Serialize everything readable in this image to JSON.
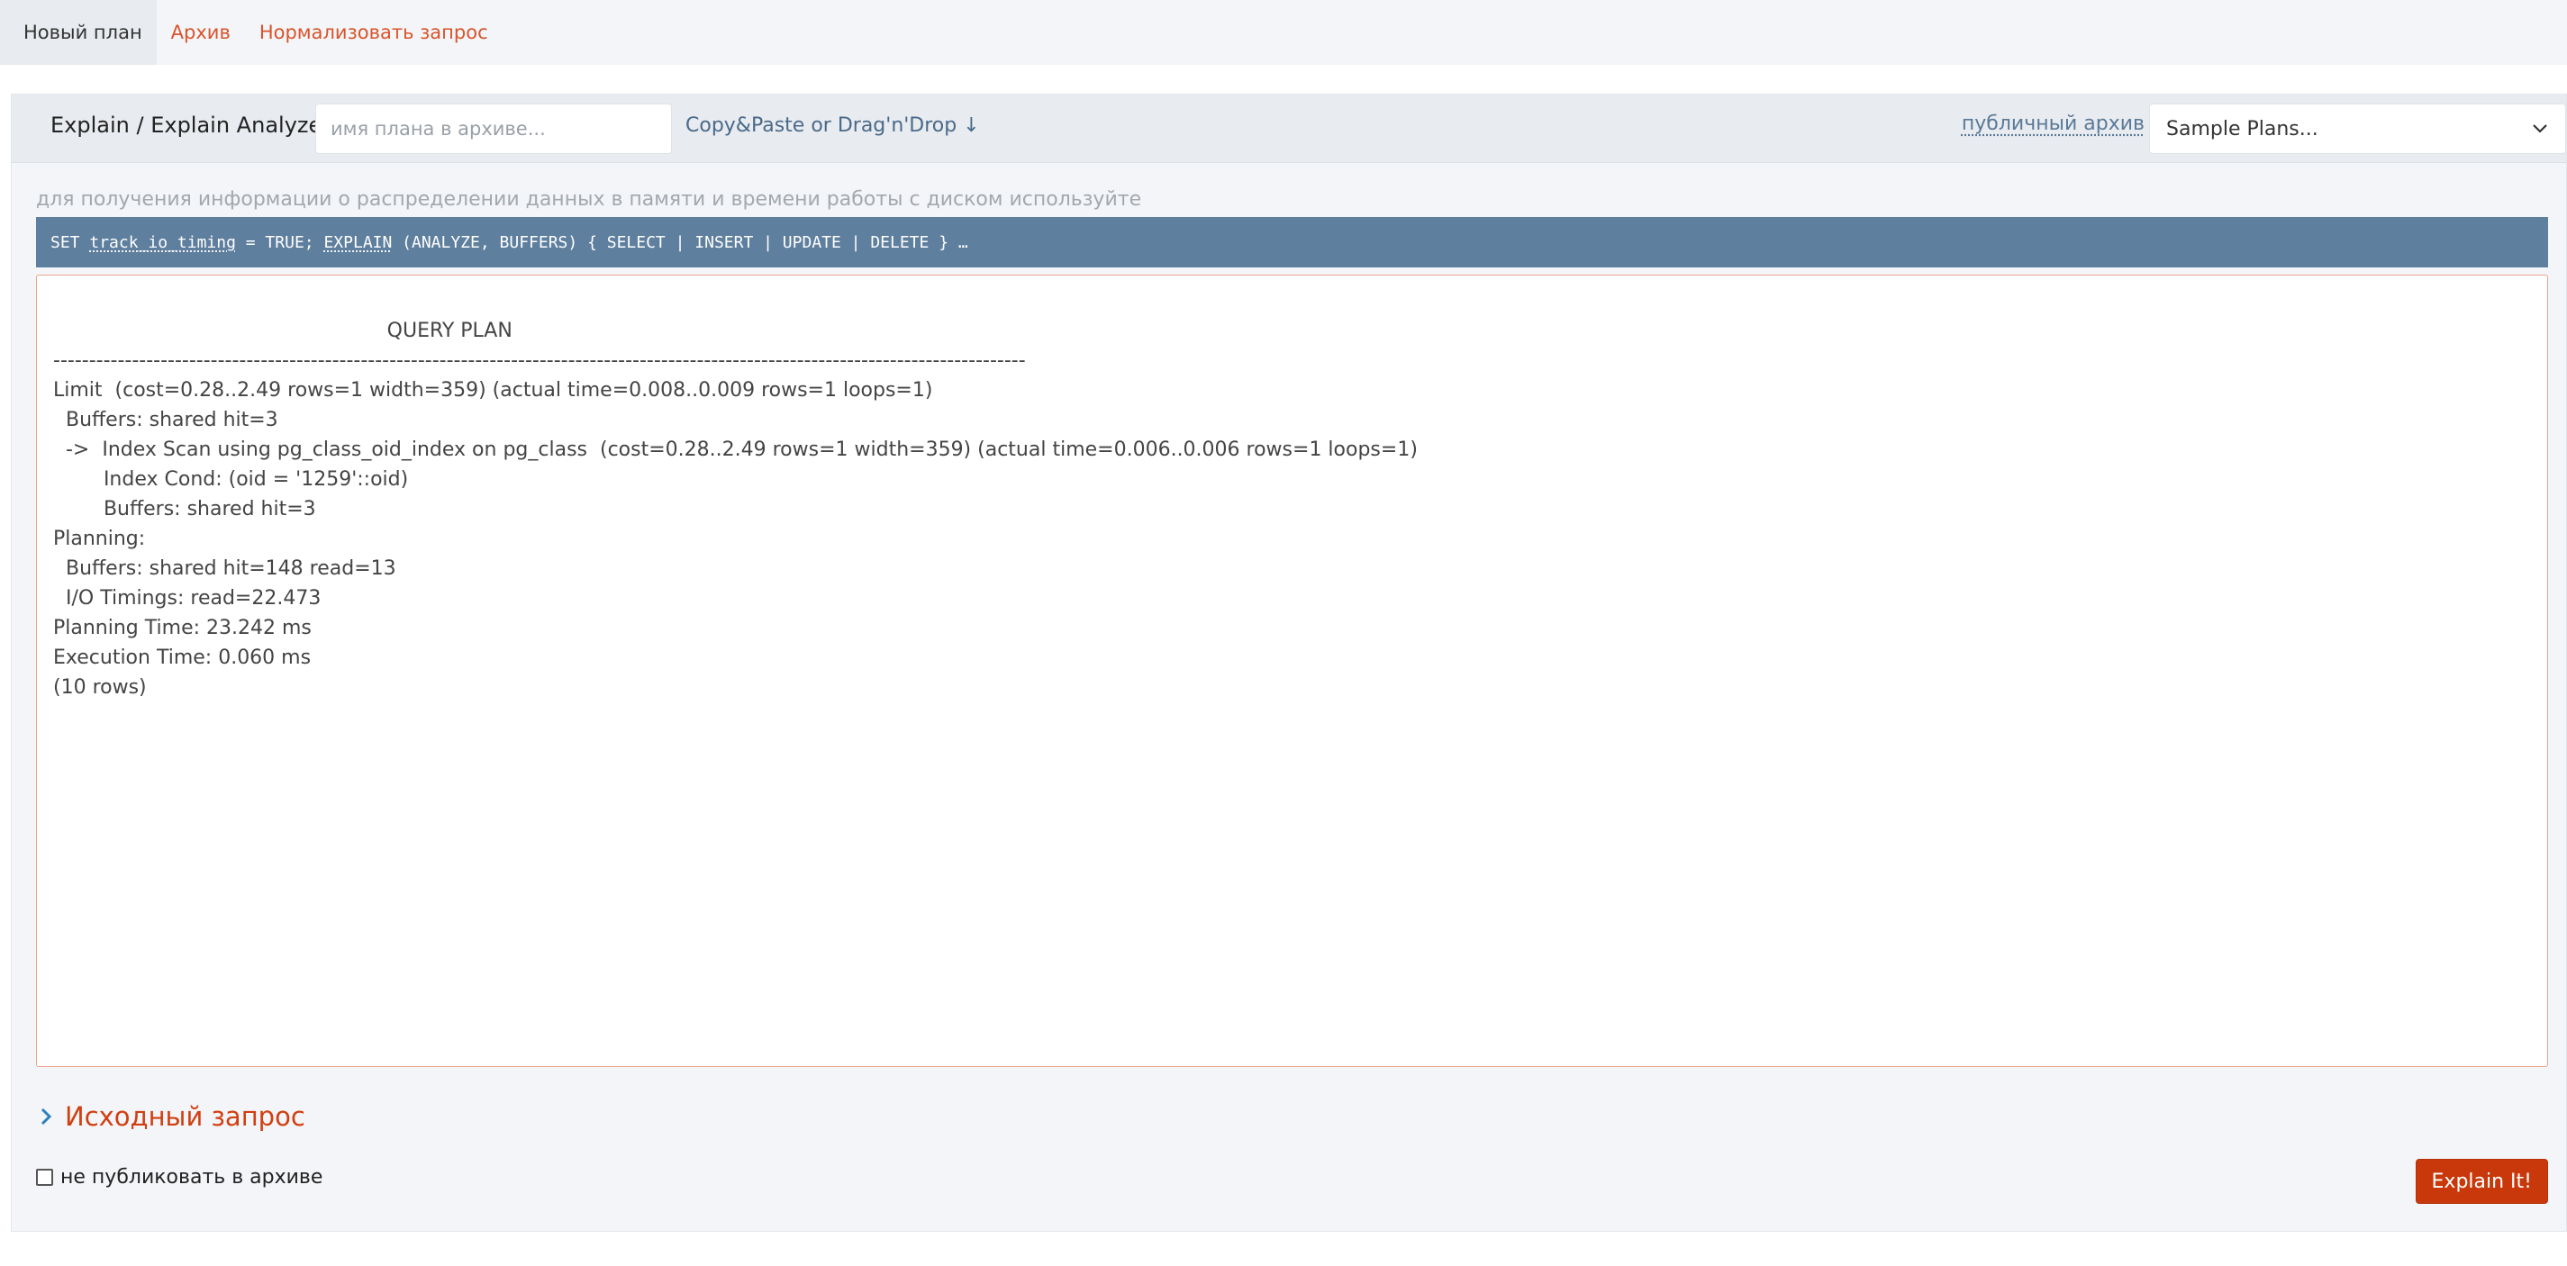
{
  "nav": {
    "tabs": [
      {
        "label": "Новый план",
        "active": true
      },
      {
        "label": "Архив",
        "active": false
      },
      {
        "label": "Нормализовать запрос",
        "active": false
      }
    ]
  },
  "toolbar": {
    "title": "Explain / Explain Analyze",
    "plan_name_placeholder": "имя плана в архиве...",
    "copy_paste_label": "Copy&Paste or Drag'n'Drop ↓",
    "public_archive_label": "публичный архив",
    "sample_select_value": "Sample Plans..."
  },
  "hint": {
    "text": "для получения информации о распределении данных в памяти и времени работы с диском используйте",
    "code_parts": [
      "SET ",
      "track_io_timing",
      " = TRUE; ",
      "EXPLAIN",
      " (ANALYZE, BUFFERS) { SELECT | INSERT | UPDATE | DELETE } …"
    ]
  },
  "plan_text": "                                                 QUERY PLAN\n----------------------------------------------------------------------------------------------------------------------------------------\nLimit  (cost=0.28..2.49 rows=1 width=359) (actual time=0.008..0.009 rows=1 loops=1)\n  Buffers: shared hit=3\n  ->  Index Scan using pg_class_oid_index on pg_class  (cost=0.28..2.49 rows=1 width=359) (actual time=0.006..0.006 rows=1 loops=1)\n        Index Cond: (oid = '1259'::oid)\n        Buffers: shared hit=3\nPlanning:\n  Buffers: shared hit=148 read=13\n  I/O Timings: read=22.473\nPlanning Time: 23.242 ms\nExecution Time: 0.060 ms\n(10 rows)",
  "source_query": {
    "title": "Исходный запрос"
  },
  "footer": {
    "no_publish_label": "не публиковать в архиве",
    "no_publish_checked": false,
    "explain_button": "Explain It!"
  },
  "colors": {
    "accent": "#d23f10",
    "button": "#c9380a",
    "code_bar": "#5f7f9e",
    "link": "#4a6a8a"
  }
}
